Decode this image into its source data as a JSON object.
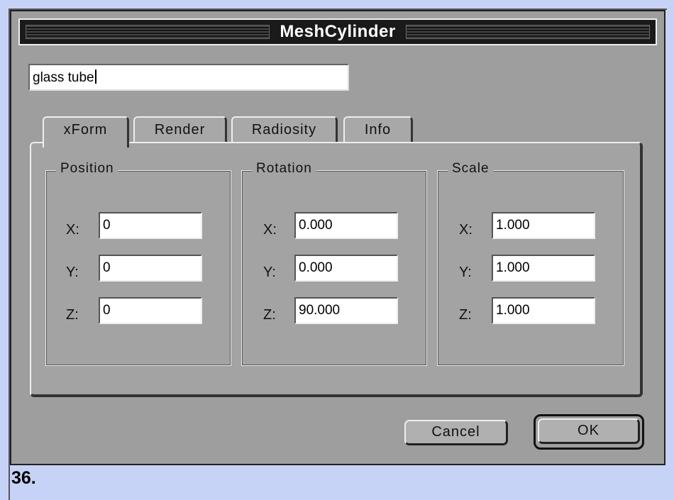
{
  "window": {
    "title": "MeshCylinder"
  },
  "name_field": {
    "value": "glass tube"
  },
  "tabs": [
    {
      "label": "xForm",
      "active": true
    },
    {
      "label": "Render",
      "active": false
    },
    {
      "label": "Radiosity",
      "active": false
    },
    {
      "label": "Info",
      "active": false
    }
  ],
  "groups": {
    "position": {
      "label": "Position",
      "x_label": "X:",
      "y_label": "Y:",
      "z_label": "Z:",
      "x": "0",
      "y": "0",
      "z": "0"
    },
    "rotation": {
      "label": "Rotation",
      "x_label": "X:",
      "y_label": "Y:",
      "z_label": "Z:",
      "x": "0.000",
      "y": "0.000",
      "z": "90.000"
    },
    "scale": {
      "label": "Scale",
      "x_label": "X:",
      "y_label": "Y:",
      "z_label": "Z:",
      "x": "1.000",
      "y": "1.000",
      "z": "1.000"
    }
  },
  "buttons": {
    "cancel": "Cancel",
    "ok": "OK"
  },
  "caption": "36."
}
